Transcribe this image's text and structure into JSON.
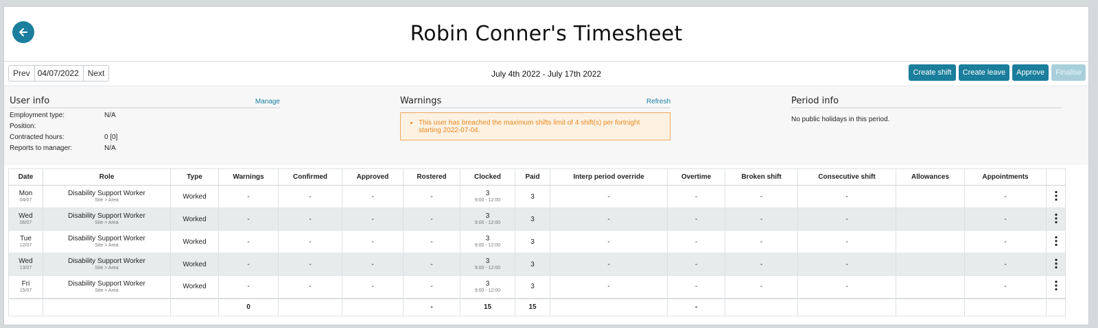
{
  "header": {
    "title": "Robin Conner's Timesheet"
  },
  "toolbar": {
    "prev_label": "Prev",
    "date_value": "04/07/2022",
    "next_label": "Next",
    "date_range": "July 4th 2022 - July 17th 2022",
    "actions": [
      "Create shift",
      "Create leave",
      "Approve",
      "Finalise"
    ]
  },
  "user_info": {
    "title": "User info",
    "manage_label": "Manage",
    "fields": [
      {
        "key": "Employment type:",
        "value": "N/A"
      },
      {
        "key": "Position:",
        "value": ""
      },
      {
        "key": "Contracted hours:",
        "value": "0 [0]"
      },
      {
        "key": "Reports to manager:",
        "value": "N/A"
      }
    ]
  },
  "warnings": {
    "title": "Warnings",
    "refresh_label": "Refresh",
    "message": "This user has breached the maximum shifts limit of 4 shift(s) per fortnight starting 2022-07-04."
  },
  "period_info": {
    "title": "Period info",
    "text": "No public holidays in this period."
  },
  "table": {
    "columns": [
      "Date",
      "Role",
      "Type",
      "Warnings",
      "Confirmed",
      "Approved",
      "Rostered",
      "Clocked",
      "Paid",
      "Interp period override",
      "Overtime",
      "Broken shift",
      "Consecutive shift",
      "Allowances",
      "Appointments",
      ""
    ],
    "rows": [
      {
        "day": "Mon",
        "date": "04/07",
        "role": "Disability Support Worker",
        "site": "Site > Area",
        "type": "Worked",
        "warnings": "-",
        "confirmed": "-",
        "approved": "-",
        "rostered": "-",
        "clocked": "3",
        "clocked_time": "9:00 - 12:00",
        "paid": "3",
        "interp": "-",
        "overtime": "-",
        "broken": "-",
        "consecutive": "-",
        "allowances": "",
        "appointments": "-"
      },
      {
        "day": "Wed",
        "date": "06/07",
        "role": "Disability Support Worker",
        "site": "Site > Area",
        "type": "Worked",
        "warnings": "-",
        "confirmed": "-",
        "approved": "-",
        "rostered": "-",
        "clocked": "3",
        "clocked_time": "9:00 - 12:00",
        "paid": "3",
        "interp": "-",
        "overtime": "-",
        "broken": "-",
        "consecutive": "-",
        "allowances": "",
        "appointments": "-"
      },
      {
        "day": "Tue",
        "date": "12/07",
        "role": "Disability Support Worker",
        "site": "Site > Area",
        "type": "Worked",
        "warnings": "-",
        "confirmed": "-",
        "approved": "-",
        "rostered": "-",
        "clocked": "3",
        "clocked_time": "9:00 - 12:00",
        "paid": "3",
        "interp": "-",
        "overtime": "-",
        "broken": "-",
        "consecutive": "-",
        "allowances": "",
        "appointments": "-"
      },
      {
        "day": "Wed",
        "date": "13/07",
        "role": "Disability Support Worker",
        "site": "Site > Area",
        "type": "Worked",
        "warnings": "-",
        "confirmed": "-",
        "approved": "-",
        "rostered": "-",
        "clocked": "3",
        "clocked_time": "9:00 - 12:00",
        "paid": "3",
        "interp": "-",
        "overtime": "-",
        "broken": "-",
        "consecutive": "-",
        "allowances": "",
        "appointments": "-"
      },
      {
        "day": "Fri",
        "date": "15/07",
        "role": "Disability Support Worker",
        "site": "Site > Area",
        "type": "Worked",
        "warnings": "-",
        "confirmed": "-",
        "approved": "-",
        "rostered": "-",
        "clocked": "3",
        "clocked_time": "9:00 - 12:00",
        "paid": "3",
        "interp": "-",
        "overtime": "-",
        "broken": "-",
        "consecutive": "-",
        "allowances": "",
        "appointments": "-"
      }
    ],
    "totals": {
      "warnings": "0",
      "rostered": "-",
      "clocked": "15",
      "paid": "15",
      "overtime": "-"
    }
  },
  "colors": {
    "accent": "#1a7e9c",
    "warning_text": "#ea8a21",
    "warning_bg": "#fdf1e2",
    "row_alt": "#e8ebec"
  },
  "icons": {
    "back": "arrow-left-icon",
    "row_menu": "kebab-menu-icon"
  }
}
